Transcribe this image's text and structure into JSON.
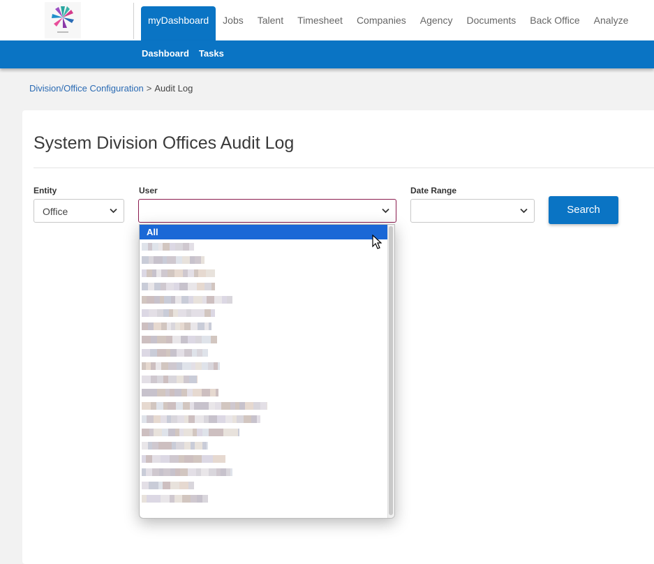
{
  "nav": {
    "items": [
      "myDashboard",
      "Jobs",
      "Talent",
      "Timesheet",
      "Companies",
      "Agency",
      "Documents",
      "Back Office",
      "Analyze"
    ],
    "active": "myDashboard"
  },
  "subnav": {
    "items": [
      "Dashboard",
      "Tasks"
    ]
  },
  "breadcrumb": {
    "parent": "Division/Office Configuration",
    "separator": ">",
    "current": "Audit Log"
  },
  "page": {
    "title": "System Division Offices Audit Log"
  },
  "filters": {
    "entity": {
      "label": "Entity",
      "value": "Office"
    },
    "user": {
      "label": "User",
      "value": ""
    },
    "date_range": {
      "label": "Date Range",
      "value": ""
    },
    "search_label": "Search"
  },
  "user_dropdown": {
    "first_option": "All",
    "blurred_option_count": 20
  },
  "colors": {
    "primary": "#0a74c4",
    "focus_border": "#8b1b4f",
    "option_highlight": "#1a68d6",
    "link": "#2a6ab3"
  }
}
